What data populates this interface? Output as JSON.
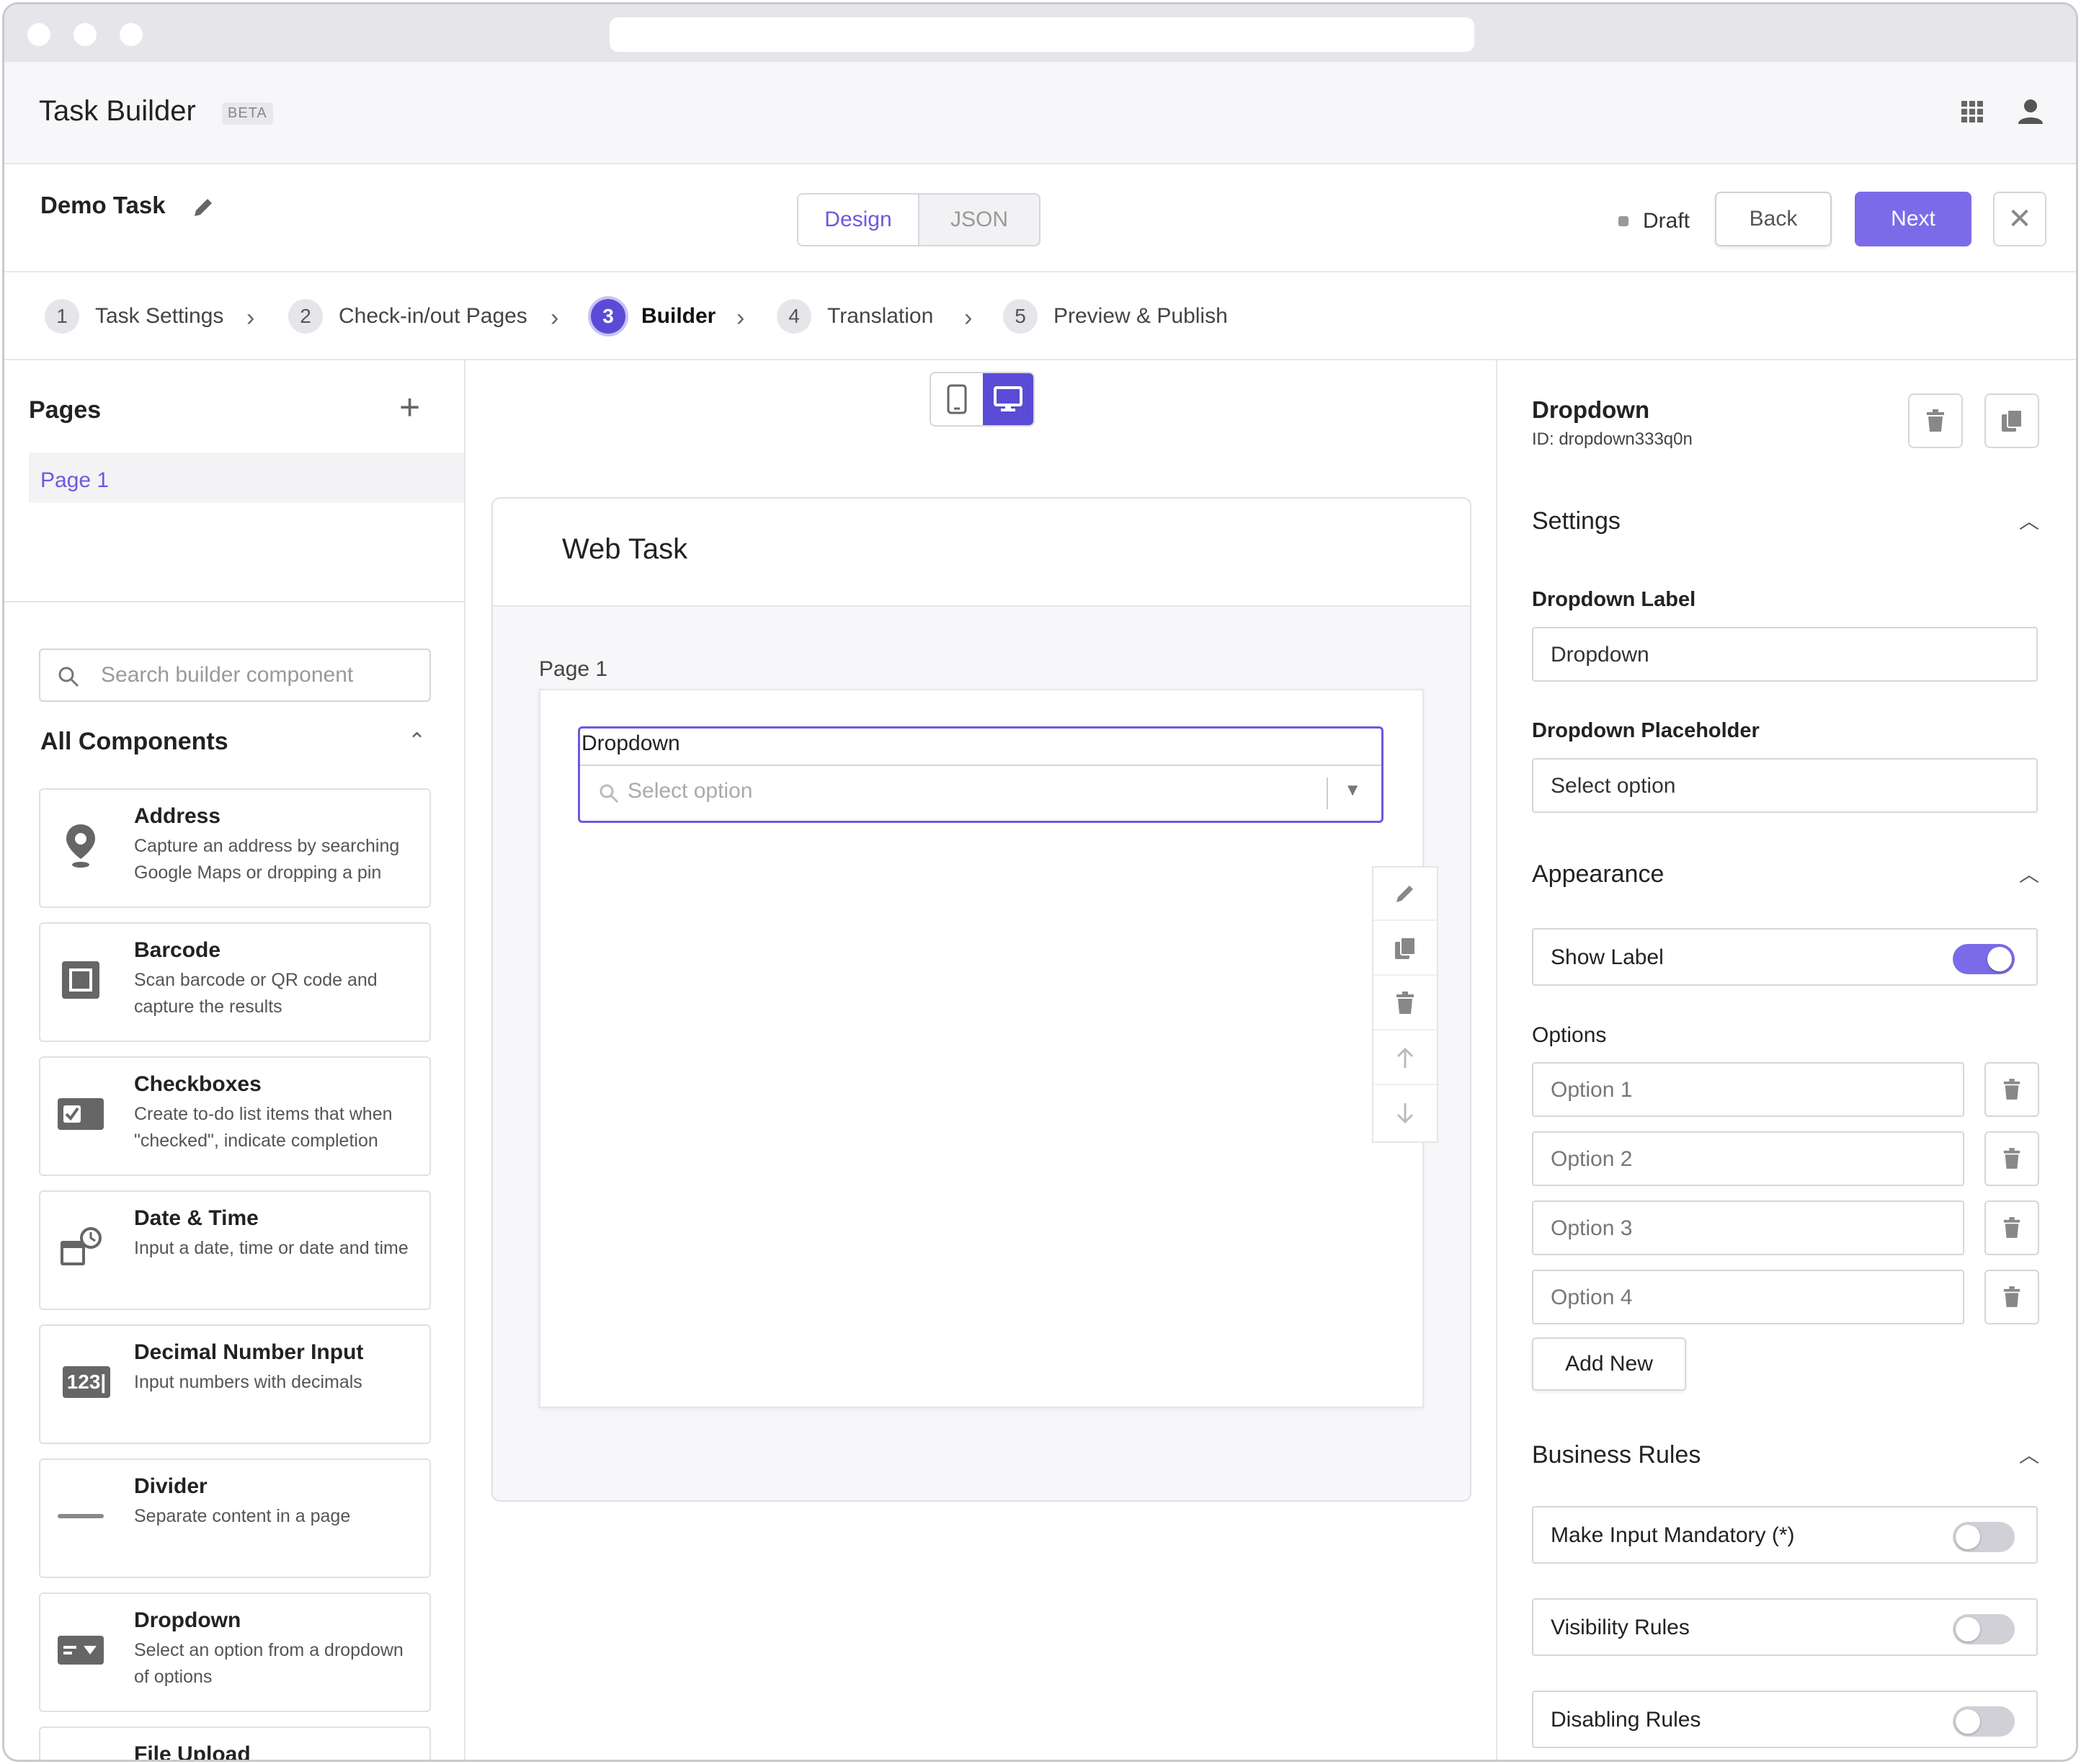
{
  "colors": {
    "accent": "#7b6be8",
    "accent_dark": "#5a4bd6",
    "border": "#d6d6dc"
  },
  "app": {
    "title": "Task Builder",
    "badge": "BETA"
  },
  "task": {
    "name": "Demo Task",
    "tabs": {
      "design": "Design",
      "json": "JSON",
      "active": "Design"
    },
    "status": "Draft",
    "back_label": "Back",
    "next_label": "Next"
  },
  "steps": [
    {
      "num": "1",
      "label": "Task Settings"
    },
    {
      "num": "2",
      "label": "Check-in/out Pages"
    },
    {
      "num": "3",
      "label": "Builder",
      "active": true
    },
    {
      "num": "4",
      "label": "Translation"
    },
    {
      "num": "5",
      "label": "Preview & Publish"
    }
  ],
  "left": {
    "pages_title": "Pages",
    "pages": [
      "Page 1"
    ],
    "search_placeholder": "Search builder component",
    "components_title": "All Components",
    "components": [
      {
        "title": "Address",
        "desc": "Capture an address by searching Google Maps or dropping a pin",
        "icon": "map-pin-icon"
      },
      {
        "title": "Barcode",
        "desc": "Scan barcode or QR code and capture the results",
        "icon": "barcode-scan-icon"
      },
      {
        "title": "Checkboxes",
        "desc": "Create to-do list items that when \"checked\", indicate completion",
        "icon": "checkbox-icon"
      },
      {
        "title": "Date & Time",
        "desc": "Input a date, time or date and time",
        "icon": "calendar-clock-icon"
      },
      {
        "title": "Decimal Number Input",
        "desc": "Input numbers with decimals",
        "icon": "number-input-icon",
        "icon_text": "123|"
      },
      {
        "title": "Divider",
        "desc": "Separate content in a page",
        "icon": "divider-icon"
      },
      {
        "title": "Dropdown",
        "desc": "Select an option from a dropdown of options",
        "icon": "dropdown-icon"
      },
      {
        "title": "File Upload",
        "desc": "",
        "icon": "upload-icon"
      }
    ]
  },
  "canvas": {
    "title": "Web Task",
    "page_label": "Page 1",
    "field": {
      "label": "Dropdown",
      "placeholder": "Select option"
    }
  },
  "right": {
    "component_title": "Dropdown",
    "component_id": "ID: dropdown333q0n",
    "settings_title": "Settings",
    "dropdown_label_title": "Dropdown Label",
    "dropdown_label_value": "Dropdown",
    "placeholder_title": "Dropdown Placeholder",
    "placeholder_value": "Select option",
    "appearance_title": "Appearance",
    "show_label": {
      "label": "Show Label",
      "on": true
    },
    "options_title": "Options",
    "options": [
      "Option 1",
      "Option 2",
      "Option 3",
      "Option 4"
    ],
    "add_new_label": "Add New",
    "business_rules_title": "Business Rules",
    "rules": [
      {
        "label": "Make Input Mandatory (*)",
        "on": false
      },
      {
        "label": "Visibility Rules",
        "on": false
      },
      {
        "label": "Disabling Rules",
        "on": false
      }
    ]
  }
}
